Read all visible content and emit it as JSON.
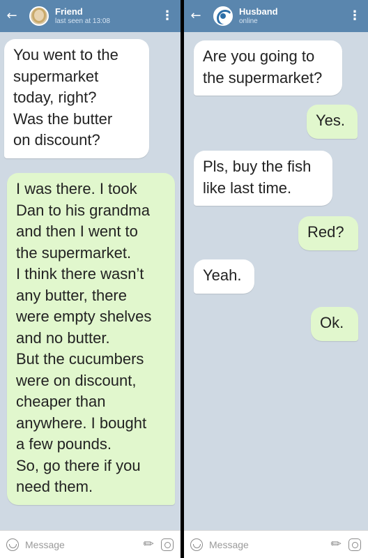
{
  "left_chat": {
    "contact_name": "Friend",
    "status": "last seen at 13:08",
    "back_icon": "←",
    "menu_icon": "⋮",
    "messages": [
      {
        "direction": "incoming",
        "lines": [
          "You went to the",
          "supermarket",
          "today, right?",
          "Was the butter",
          "on discount?"
        ]
      },
      {
        "direction": "outgoing",
        "lines": [
          "I was there. I took",
          "Dan to his grandma",
          "and then I went to",
          "the supermarket.",
          "I think there wasn’t",
          "any butter, there",
          "were empty shelves",
          "and no butter.",
          "But the cucumbers",
          "were on discount,",
          "cheaper than",
          "anywhere. I bought",
          "a few pounds.",
          "So, go there if you",
          "need them."
        ]
      }
    ],
    "input_placeholder": "Message"
  },
  "right_chat": {
    "contact_name": "Husband",
    "status": "online",
    "back_icon": "←",
    "menu_icon": "⋮",
    "messages": [
      {
        "direction": "incoming",
        "lines": [
          "Are you going to",
          "the supermarket?"
        ]
      },
      {
        "direction": "outgoing",
        "lines": [
          "Yes."
        ]
      },
      {
        "direction": "incoming",
        "lines": [
          "Pls, buy the fish",
          "like last time."
        ]
      },
      {
        "direction": "outgoing",
        "lines": [
          "Red?"
        ]
      },
      {
        "direction": "incoming",
        "lines": [
          "Yeah."
        ]
      },
      {
        "direction": "outgoing",
        "lines": [
          "Ok."
        ]
      }
    ],
    "input_placeholder": "Message"
  },
  "colors": {
    "header": "#5a86ae",
    "background": "#cfd9e3",
    "incoming_bubble": "#ffffff",
    "outgoing_bubble": "#e1f7cd"
  },
  "icons": [
    "arrow-left-icon",
    "kebab-menu-icon",
    "smiley-icon",
    "paperclip-icon",
    "camera-icon"
  ]
}
